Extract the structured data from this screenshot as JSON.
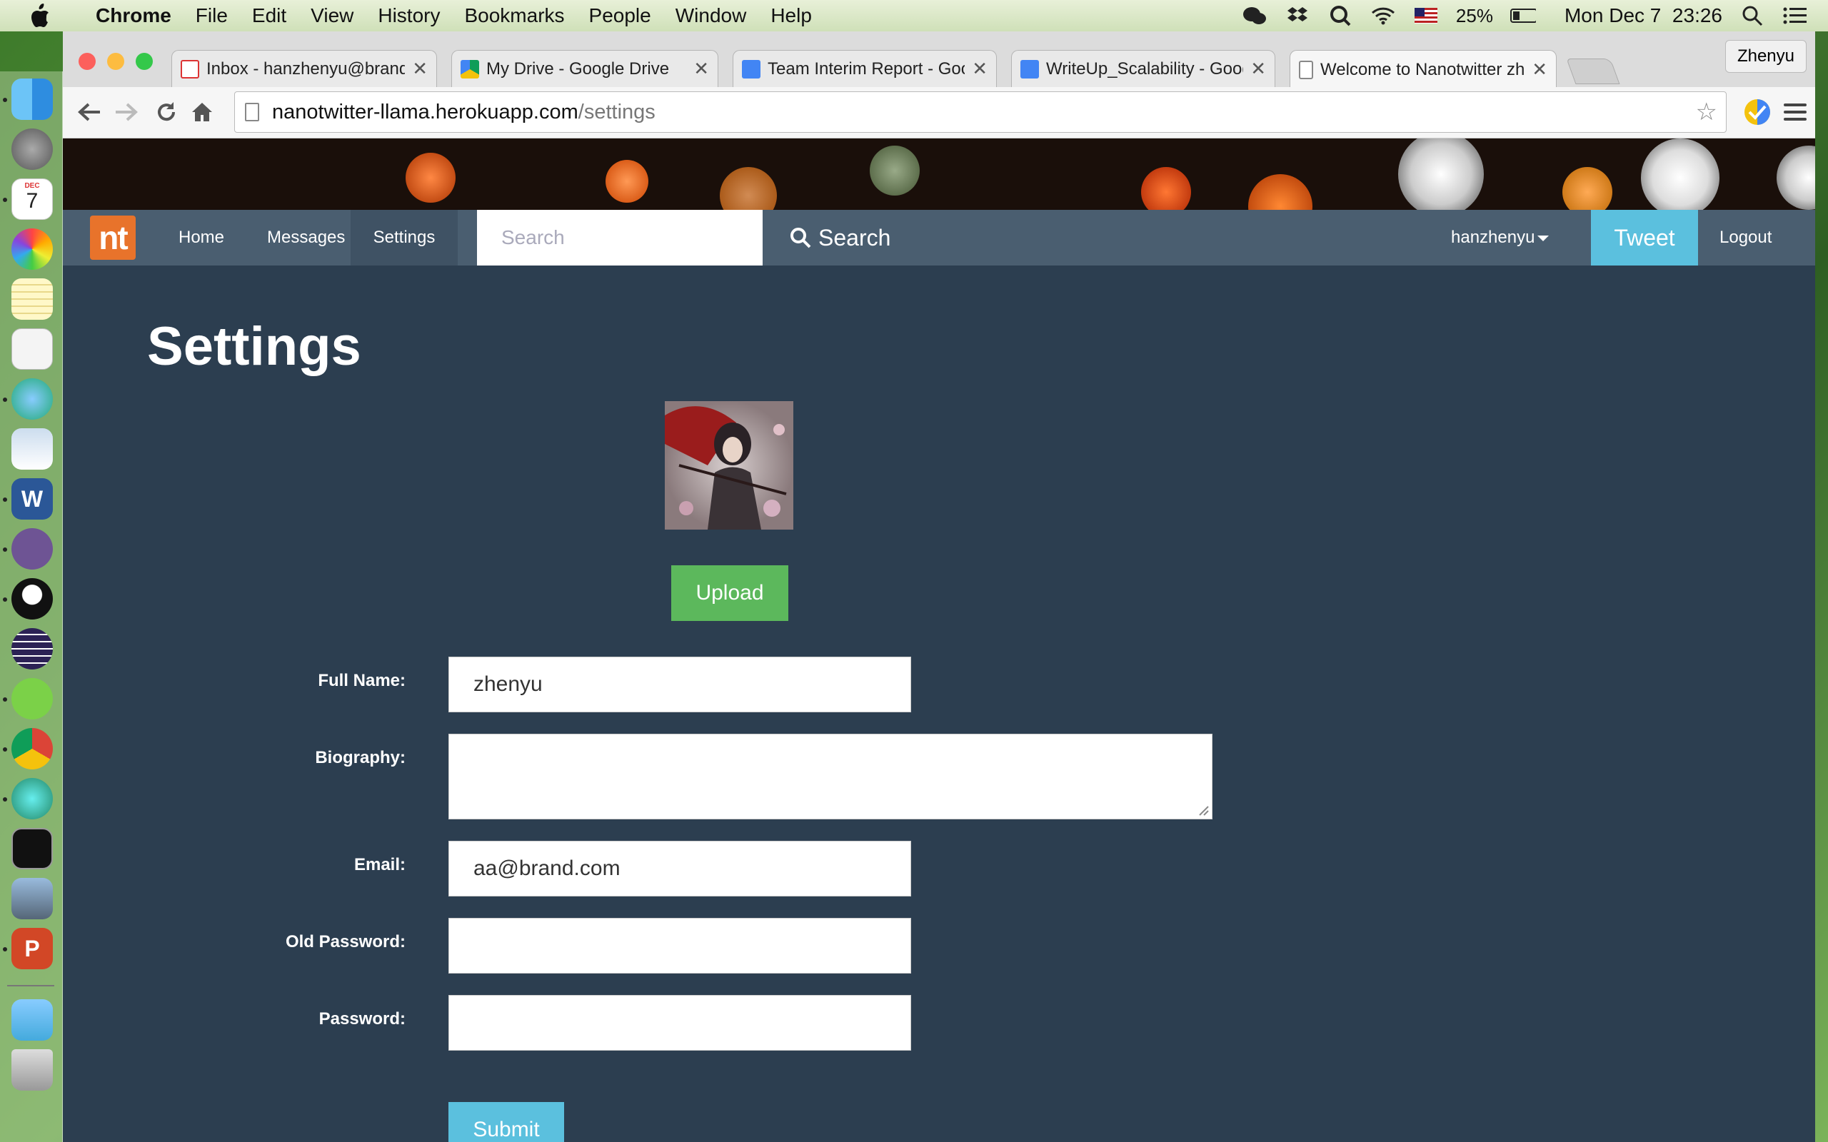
{
  "menubar": {
    "app_name": "Chrome",
    "items": [
      "File",
      "Edit",
      "View",
      "History",
      "Bookmarks",
      "People",
      "Window",
      "Help"
    ],
    "battery": "25%",
    "clock": "Mon Dec 7  23:26"
  },
  "dock": {
    "icons": [
      "finder-icon",
      "launchpad-icon",
      "calendar-icon",
      "photos-icon",
      "notes-icon",
      "textedit-icon",
      "maps-icon",
      "preview-icon",
      "word-icon",
      "github-icon",
      "qq-icon",
      "eclipse-icon",
      "wechat-icon",
      "chrome-icon",
      "atom-icon",
      "terminal-icon",
      "image-capture-icon",
      "powerpoint-icon",
      "folder-icon",
      "trash-icon"
    ],
    "calendar_month": "DEC",
    "calendar_day": "7"
  },
  "browser": {
    "tabs": [
      {
        "title": "Inbox - hanzhenyu@brande",
        "icon": "gmail-icon"
      },
      {
        "title": "My Drive - Google Drive",
        "icon": "google-drive-icon"
      },
      {
        "title": "Team Interim Report - Goo",
        "icon": "google-docs-icon"
      },
      {
        "title": "WriteUp_Scalability - Goog",
        "icon": "google-docs-icon"
      },
      {
        "title": "Welcome to Nanotwitter zh",
        "icon": "page-icon"
      }
    ],
    "profile_name": "Zhenyu",
    "url_host": "nanotwitter-llama.herokuapp.com",
    "url_path": "/settings"
  },
  "site": {
    "logo": "nt",
    "nav": {
      "home": "Home",
      "messages": "Messages",
      "settings": "Settings"
    },
    "search_placeholder": "Search",
    "search_button": "Search",
    "username": "hanzhenyu",
    "tweet_button": "Tweet",
    "logout": "Logout"
  },
  "settings": {
    "title": "Settings",
    "upload_button": "Upload",
    "labels": {
      "full_name": "Full Name:",
      "biography": "Biography:",
      "email": "Email:",
      "old_password": "Old Password:",
      "password": "Password:"
    },
    "values": {
      "full_name": "zhenyu",
      "biography": "",
      "email": "aa@brand.com",
      "old_password": "",
      "password": ""
    },
    "submit_button": "Submit"
  },
  "colors": {
    "page_bg": "#2c3e50",
    "navbar_bg": "#4a5e70",
    "logo_orange": "#e8732b",
    "tweet_blue": "#5bc0de",
    "upload_green": "#5cb85c"
  }
}
